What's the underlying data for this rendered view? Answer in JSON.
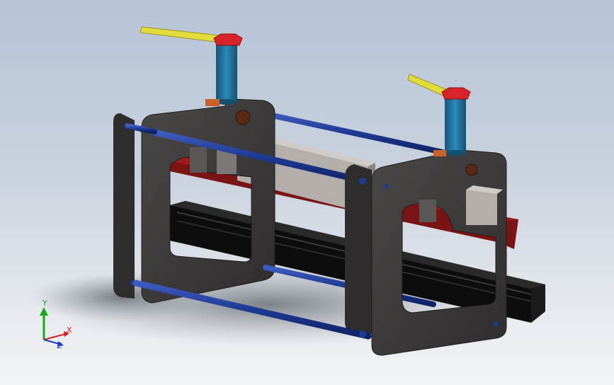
{
  "viewport": {
    "background_top": "#b6c3d6",
    "background_bottom": "#f2f3f5"
  },
  "model": {
    "frame_color": "#3a3838",
    "rod_color": "#1d3a93",
    "handle_color": "#e0dc3c",
    "knob_color": "#d8232a",
    "screw_color": "#1f6f95",
    "rail_color": "#0d0d0d",
    "plate_color": "#7a1313",
    "block_color": "#b5b0ac"
  },
  "triad": {
    "x_label": "X",
    "y_label": "Y",
    "z_label": "Z",
    "x_color": "#d62020",
    "y_color": "#1aa81a",
    "z_color": "#1e3cc8"
  }
}
